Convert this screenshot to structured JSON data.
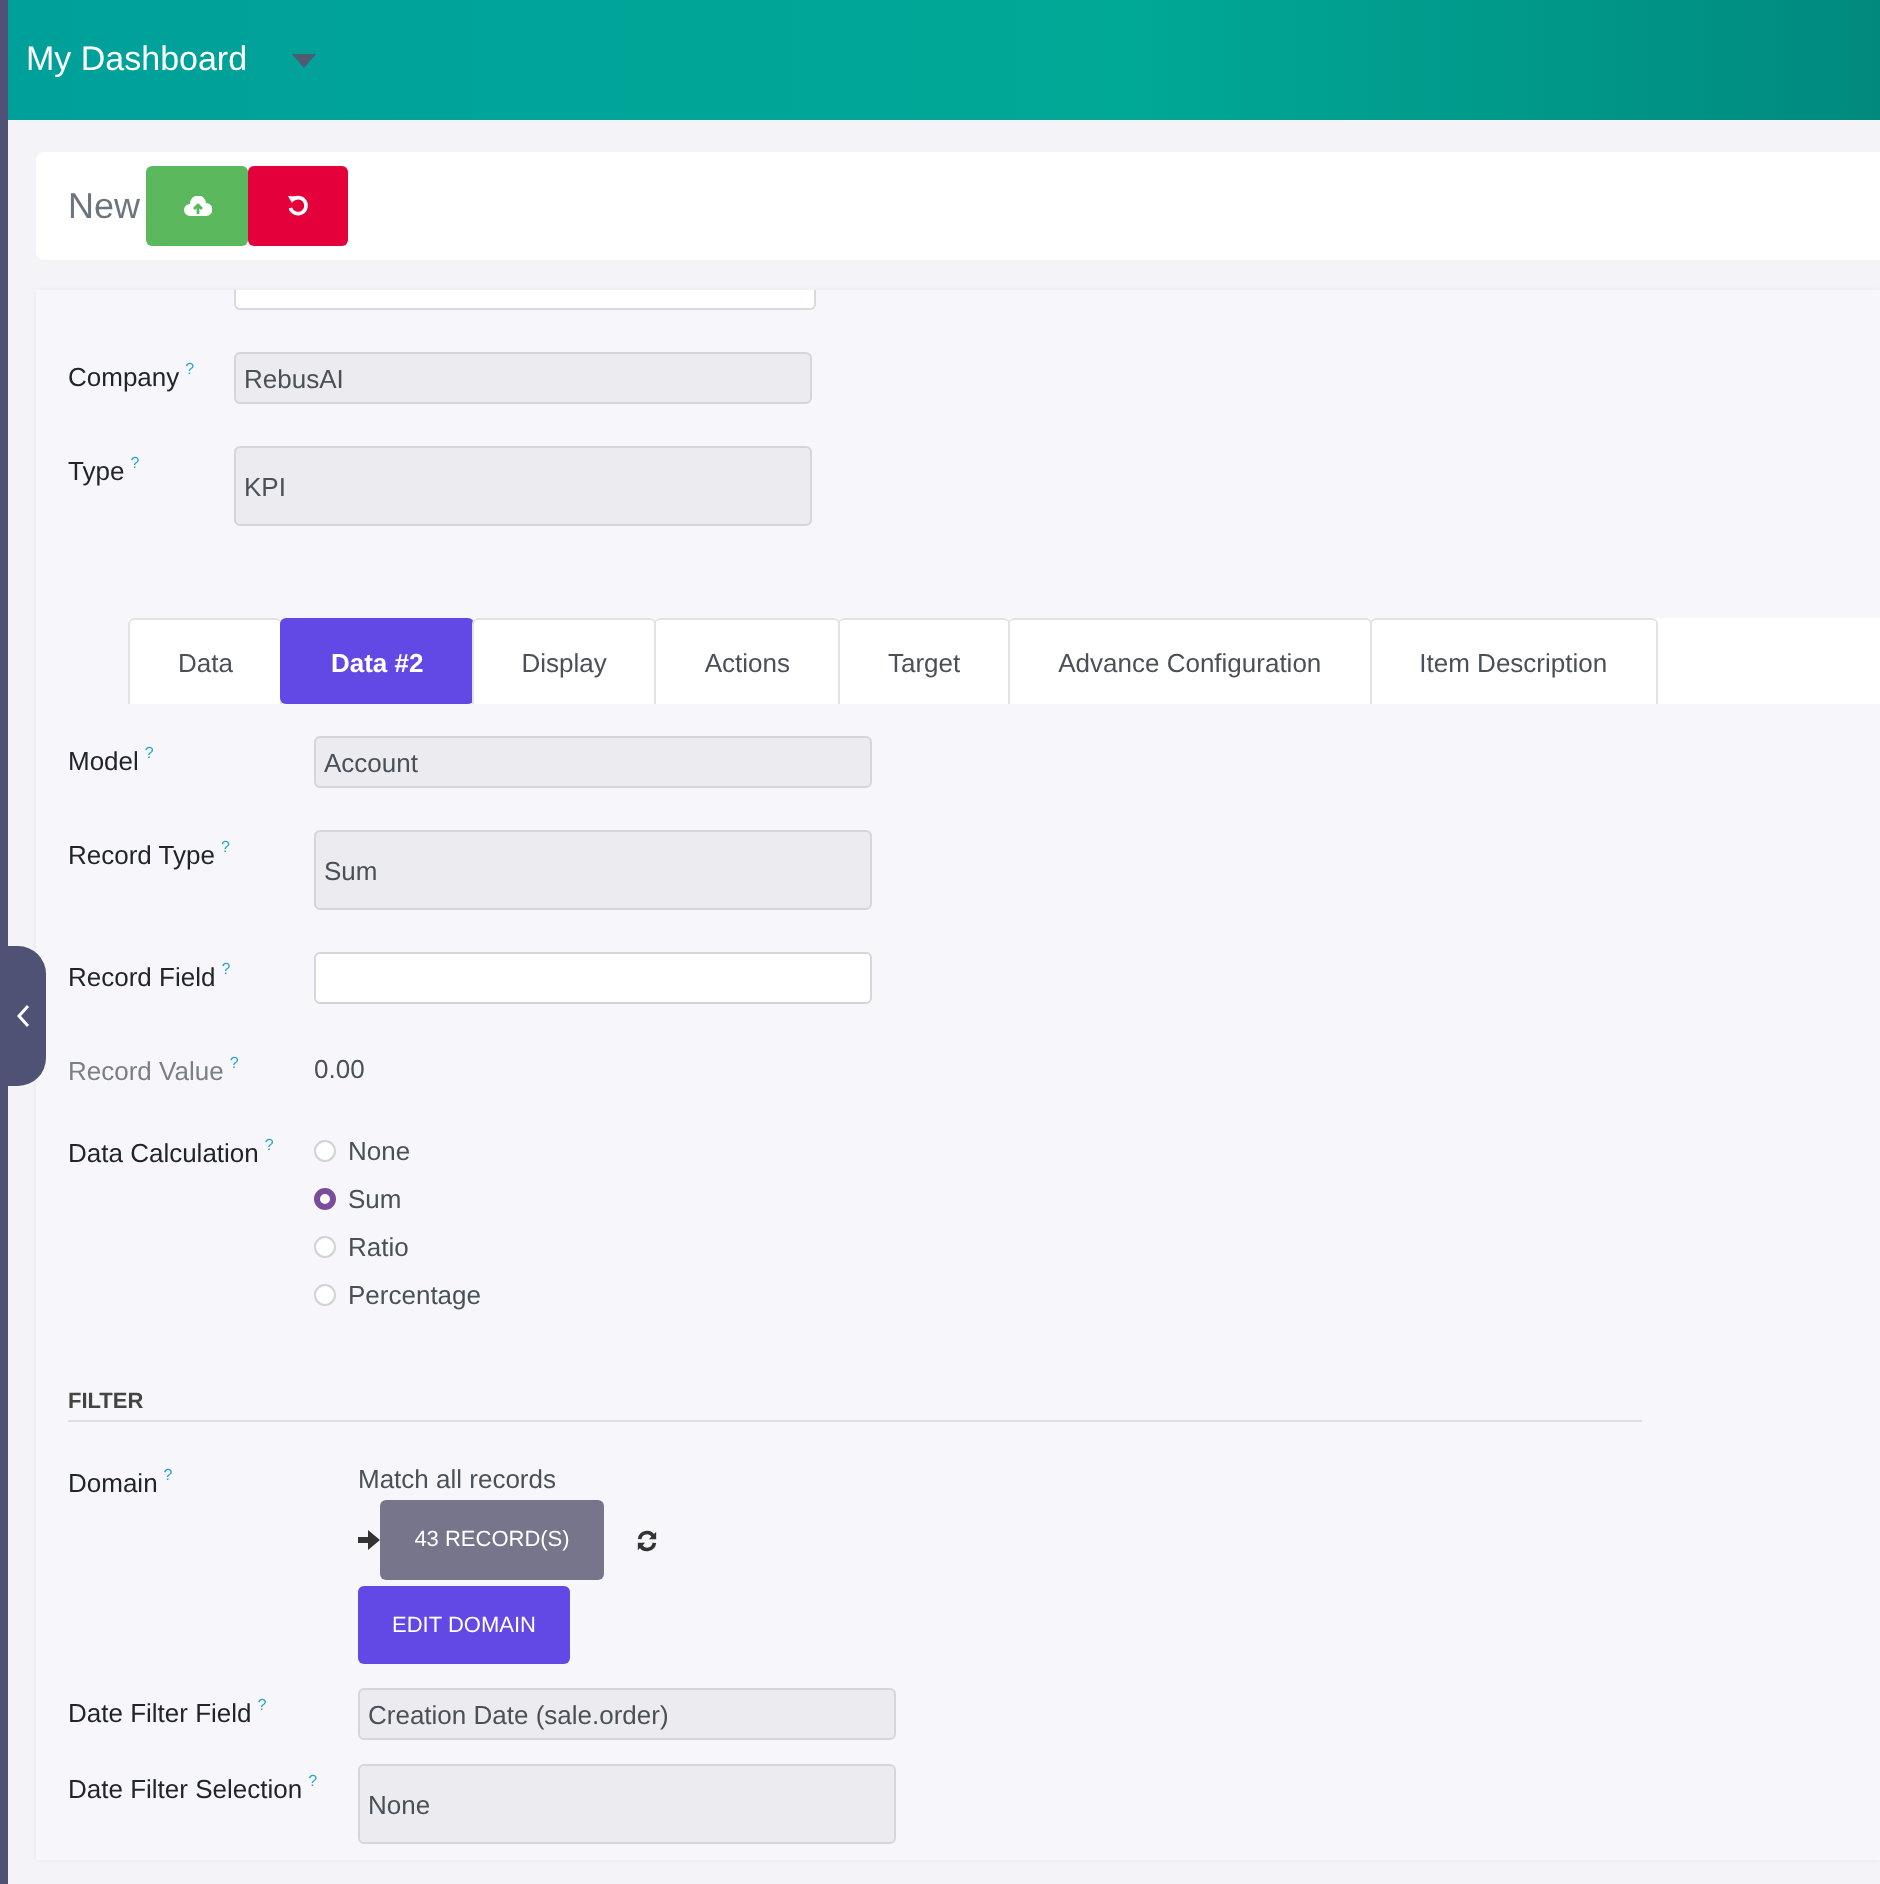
{
  "header": {
    "title": "My Dashboard"
  },
  "control_panel": {
    "breadcrumb": "New"
  },
  "top_fields": [
    {
      "label": "Company",
      "hint": "?",
      "kind": "text",
      "editable": false,
      "value": "RebusAI"
    },
    {
      "label": "Type",
      "hint": "?",
      "kind": "select",
      "editable": false,
      "value": "KPI"
    }
  ],
  "tabs": [
    {
      "label": "Data",
      "selected": false
    },
    {
      "label": "Data #2",
      "selected": true
    },
    {
      "label": "Display",
      "selected": false
    },
    {
      "label": "Actions",
      "selected": false
    },
    {
      "label": "Target",
      "selected": false
    },
    {
      "label": "Advance Configuration",
      "selected": false
    },
    {
      "label": "Item Description",
      "selected": false
    }
  ],
  "data_fields": [
    {
      "label": "Model",
      "hint": "?",
      "kind": "text",
      "editable": false,
      "muted": false,
      "value": "Account"
    },
    {
      "label": "Record Type",
      "hint": "?",
      "kind": "select",
      "editable": false,
      "muted": false,
      "value": "Sum"
    },
    {
      "label": "Record Field",
      "hint": "?",
      "kind": "text",
      "editable": true,
      "muted": false
    },
    {
      "label": "Record Value",
      "hint": "?",
      "kind": "plain",
      "muted": true,
      "value": "0.00"
    },
    {
      "label": "Data Calculation",
      "hint": "?",
      "kind": "radio",
      "muted": false,
      "options": [
        {
          "label": "None",
          "selected": false
        },
        {
          "label": "Sum",
          "selected": true
        },
        {
          "label": "Ratio",
          "selected": false
        },
        {
          "label": "Percentage",
          "selected": false
        }
      ]
    }
  ],
  "filter": {
    "title": "FILTER",
    "domain": {
      "label": "Domain",
      "hint": "?",
      "summary": "Match all records",
      "records_button": "43 RECORD(S)",
      "edit_button": "EDIT DOMAIN"
    },
    "fields": [
      {
        "label": "Date Filter Field",
        "hint": "?",
        "kind": "text",
        "editable": false,
        "value": "Creation Date (sale.order)"
      },
      {
        "label": "Date Filter Selection",
        "hint": "?",
        "kind": "select",
        "editable": false,
        "value": "None"
      }
    ]
  }
}
